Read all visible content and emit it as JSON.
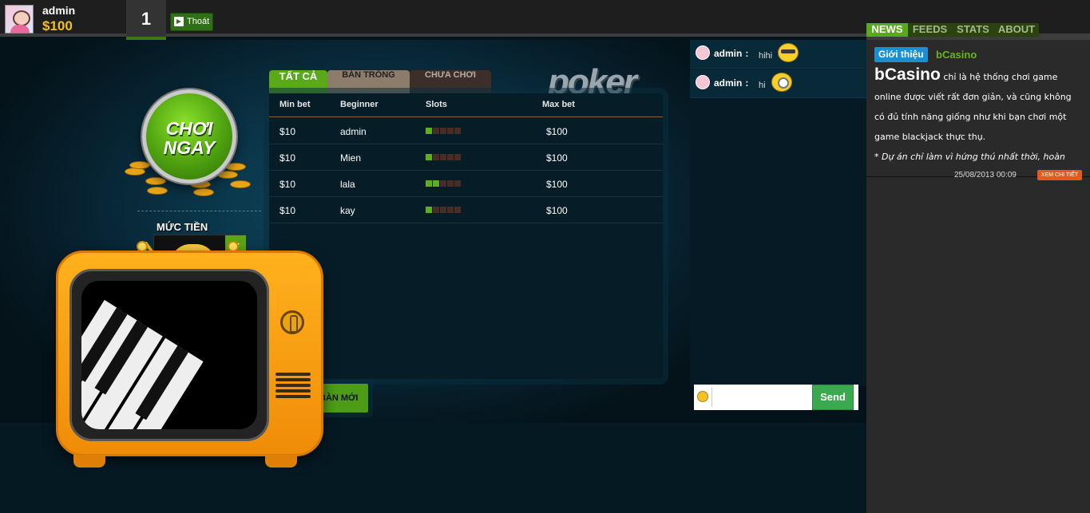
{
  "user": {
    "name": "admin",
    "balance": "$100",
    "level": "1",
    "logout_label": "Thoát"
  },
  "lobby": {
    "play_label_line1": "CHƠI",
    "play_label_line2": "NGAY",
    "money_label": "MỨC TIỀN",
    "logo": "poker",
    "tabs": [
      "TẤT CẢ",
      "BÀN TRỐNG",
      "CHƯA CHƠI"
    ],
    "columns": [
      "Min bet",
      "Beginner",
      "Slots",
      "Max bet"
    ],
    "rooms": [
      {
        "min_bet": "$10",
        "name": "admin",
        "slots_filled": 1,
        "slots_total": 5,
        "max_bet": "$100"
      },
      {
        "min_bet": "$10",
        "name": "Mien",
        "slots_filled": 1,
        "slots_total": 5,
        "max_bet": "$100"
      },
      {
        "min_bet": "$10",
        "name": "lala",
        "slots_filled": 2,
        "slots_total": 5,
        "max_bet": "$100"
      },
      {
        "min_bet": "$10",
        "name": "kay",
        "slots_filled": 1,
        "slots_total": 5,
        "max_bet": "$100"
      }
    ],
    "new_room_label": "BÀN MỚI"
  },
  "chat": {
    "messages": [
      {
        "user": "admin",
        "sep": ":",
        "text": "hihi",
        "emoticon": "sunglasses-emoticon"
      },
      {
        "user": "admin",
        "sep": ":",
        "text": "hi",
        "emoticon": "minion-emoticon"
      }
    ],
    "input_value": "",
    "send_label": "Send"
  },
  "news": {
    "tabs": [
      "NEWS",
      "FEEDS",
      "STATS",
      "ABOUT"
    ],
    "item": {
      "badge": "Giới thiệu",
      "source": "bCasino",
      "brand": "bCasino",
      "body": "chỉ là hệ thống chơi game online được viết rất đơn giản, và cũng không có đủ tính năng giống như khi bạn chơi một game blackjack thực thụ.",
      "note": "* Dự án chỉ làm vì hứng thú nhất thời, hoàn",
      "date": "25/08/2013 00:09",
      "more_label": "XEM CHI TIẾT"
    }
  },
  "colors": {
    "accent_green": "#5aa91b",
    "gold": "#f3c01a",
    "badge_blue": "#1a8fd1",
    "more_orange": "#e55a1a",
    "send_green": "#3aa94f"
  }
}
